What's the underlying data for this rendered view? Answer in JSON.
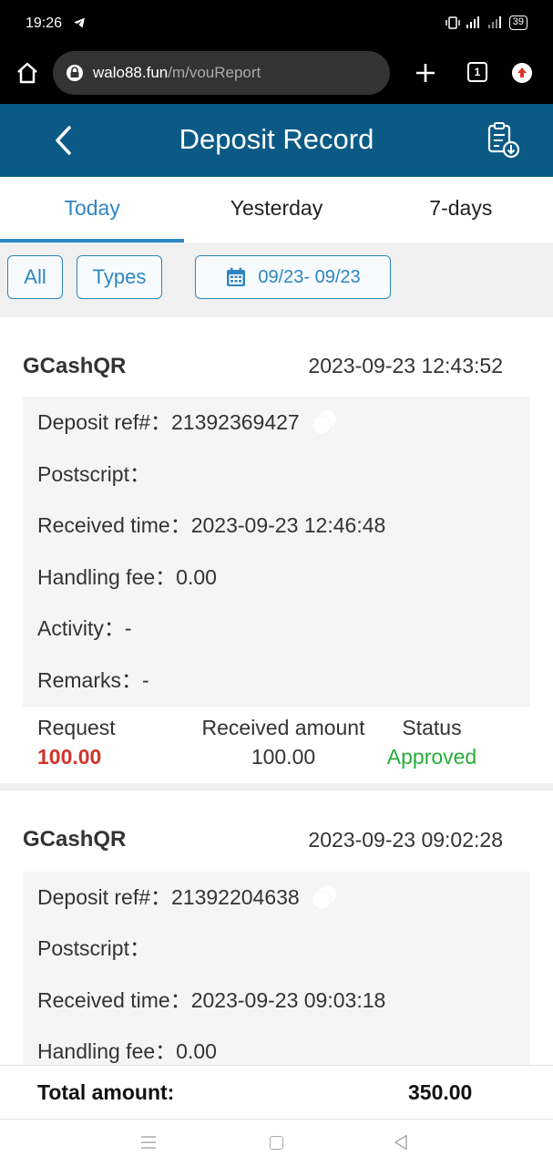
{
  "status_bar": {
    "time": "19:26",
    "battery": "39",
    "telegram_icon": "telegram-icon",
    "signal_icons": "vibrate-icon wifi-icon signal-icon"
  },
  "browser": {
    "url_host": "walo88.fun",
    "url_path": "/m/vouReport",
    "tab_count": "1"
  },
  "header": {
    "title": "Deposit Record"
  },
  "tabs": [
    {
      "label": "Today",
      "active": true
    },
    {
      "label": "Yesterday",
      "active": false
    },
    {
      "label": "7-days",
      "active": false
    }
  ],
  "filters": {
    "all": "All",
    "types": "Types",
    "date_range": "09/23- 09/23"
  },
  "records": [
    {
      "type": "GCashQR",
      "datetime": "2023-09-23 12:43:52",
      "deposit_ref": "Deposit ref#：21392369427",
      "postscript": "Postscript：",
      "received_time": "Received time：2023-09-23 12:46:48",
      "handling_fee": "Handling fee：0.00",
      "activity": "Activity：-",
      "remarks": "Remarks：-",
      "request_label": "Request",
      "request_value": "100.00",
      "received_label": "Received amount",
      "received_value": "100.00",
      "status_label": "Status",
      "status_value": "Approved"
    },
    {
      "type": "GCashQR",
      "datetime": "2023-09-23 09:02:28",
      "deposit_ref": "Deposit ref#：21392204638",
      "postscript": "Postscript：",
      "received_time": "Received time：2023-09-23 09:03:18",
      "handling_fee": "Handling fee：0.00"
    }
  ],
  "total": {
    "label": "Total amount:",
    "value": "350.00"
  },
  "colors": {
    "header": "#0b5a86",
    "accent": "#2e86c1",
    "request": "#d0342c",
    "approved": "#27ae3a"
  }
}
